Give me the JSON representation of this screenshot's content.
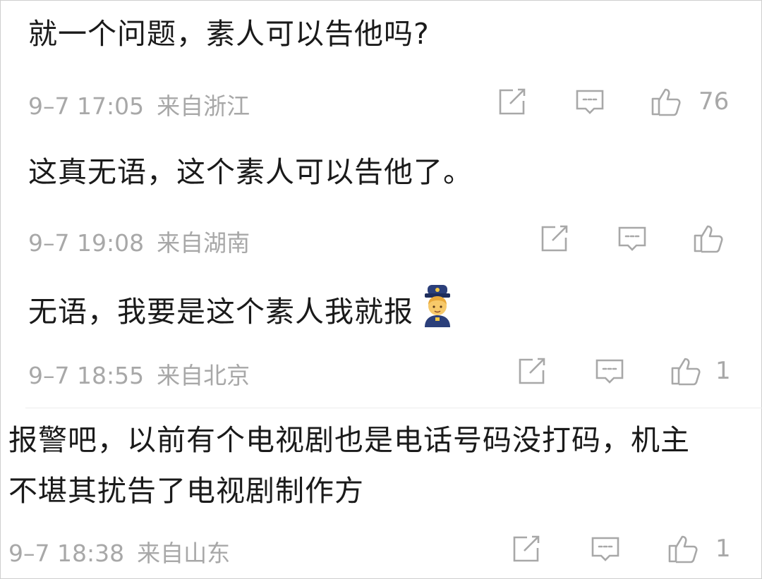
{
  "comments": [
    {
      "text": "就一个问题，素人可以告他吗?",
      "date": "9–7 17:05",
      "location": "来自浙江",
      "likes": "76"
    },
    {
      "text": "这真无语，这个素人可以告他了。",
      "date": "9–7 19:08",
      "location": "来自湖南",
      "likes": ""
    },
    {
      "text": "无语，我要是这个素人我就报",
      "emoji": "police-officer-emoji",
      "date": "9–7 18:55",
      "location": "来自北京",
      "likes": "1"
    },
    {
      "text": "报警吧，以前有个电视剧也是电话号码没打码，机主不堪其扰告了电视剧制作方",
      "date": "9–7 18:38",
      "location": "来自山东",
      "likes": "1"
    }
  ],
  "icons": {
    "repost": "edit-share-icon",
    "comment": "comment-bubble-icon",
    "like": "thumbs-up-icon"
  },
  "colors": {
    "text": "#1a1a1a",
    "meta": "#a8a8a8",
    "icon": "#a8a8a8",
    "background": "#ffffff"
  }
}
